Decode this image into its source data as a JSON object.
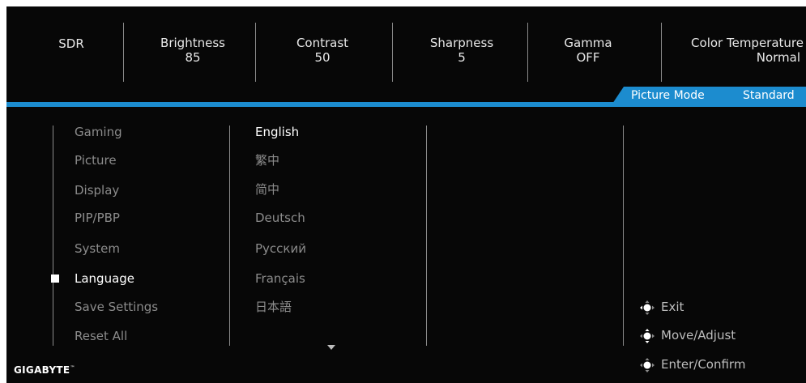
{
  "top_bar": {
    "items": [
      {
        "label": "SDR",
        "value": ""
      },
      {
        "label": "Brightness",
        "value": "85"
      },
      {
        "label": "Contrast",
        "value": "50"
      },
      {
        "label": "Sharpness",
        "value": "5"
      },
      {
        "label": "Gamma",
        "value": "OFF"
      },
      {
        "label": "Color Temperature",
        "value": "Normal"
      }
    ]
  },
  "picture_mode": {
    "label": "Picture Mode",
    "value": "Standard"
  },
  "menu": {
    "items": [
      {
        "label": "Gaming"
      },
      {
        "label": "Picture"
      },
      {
        "label": "Display"
      },
      {
        "label": "PIP/PBP"
      },
      {
        "label": "System"
      },
      {
        "label": "Language"
      },
      {
        "label": "Save Settings"
      },
      {
        "label": "Reset All"
      }
    ],
    "selected": "Language"
  },
  "languages": {
    "items": [
      {
        "label": "English"
      },
      {
        "label": "繁中"
      },
      {
        "label": "简中"
      },
      {
        "label": "Deutsch"
      },
      {
        "label": "Русский"
      },
      {
        "label": "Français"
      },
      {
        "label": "日本語"
      }
    ],
    "selected": "English"
  },
  "hints": [
    {
      "icon": "joystick-left-icon",
      "label": "Exit"
    },
    {
      "icon": "joystick-all-directions-icon",
      "label": "Move/Adjust"
    },
    {
      "icon": "joystick-press-icon",
      "label": "Enter/Confirm"
    }
  ],
  "brand": {
    "logo_text": "GIGABYTE",
    "trademark": "™"
  },
  "colors": {
    "accent": "#1c8ccf",
    "background": "#070707",
    "active_text": "#ffffff",
    "inactive_text": "#8c8c8c"
  }
}
